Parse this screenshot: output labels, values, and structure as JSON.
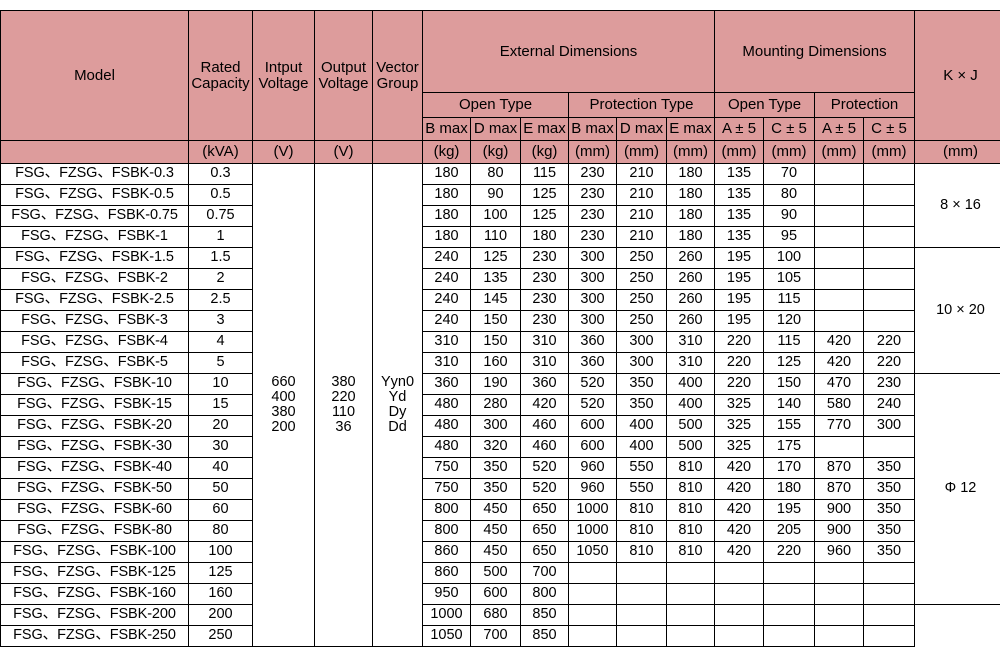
{
  "table": {
    "header": {
      "model": "Model",
      "rated_capacity": "Rated\nCapacity",
      "rated_capacity_l1": "Rated",
      "rated_capacity_l2": "Capacity",
      "input_voltage_l1": "Intput",
      "input_voltage_l2": "Voltage",
      "output_voltage_l1": "Output",
      "output_voltage_l2": "Voltage",
      "vector_group_l1": "Vector",
      "vector_group_l2": "Group",
      "external_dimensions": "External Dimensions",
      "mounting_dimensions": "Mounting Dimensions",
      "kxj": "K × J",
      "open_type": "Open Type",
      "protection_type": "Protection Type",
      "open_type_mount": "Open Type",
      "protection_mount": "Protection",
      "b_max": "B max",
      "d_max": "D max",
      "e_max": "E max",
      "a_tol": "A ± 5",
      "c_tol": "C ± 5",
      "unit_kva": "(kVA)",
      "unit_v": "(V)",
      "unit_kg": "(kg)",
      "unit_mm": "(mm)",
      "unit_blank": ""
    },
    "merged": {
      "input_voltage": "660\n400\n380\n200",
      "input_voltage_values": [
        "660",
        "400",
        "380",
        "200"
      ],
      "output_voltage": "380\n220\n110\n36",
      "output_voltage_values": [
        "380",
        "220",
        "110",
        "36"
      ],
      "vector_group": "Yyn0\nYd\nDy\nDd",
      "vector_group_values": [
        "Yyn0",
        "Yd",
        "Dy",
        "Dd"
      ]
    },
    "kxj_groups": [
      {
        "label": "8 × 16",
        "rowspan": 4
      },
      {
        "label": "10 × 20",
        "rowspan": 6
      },
      {
        "label": "Φ 12",
        "rowspan": 11
      }
    ],
    "rows": [
      {
        "model": "FSG、FZSG、FSBK-0.3",
        "capacity": "0.3",
        "ext_open_b": "180",
        "ext_open_d": "80",
        "ext_open_e": "115",
        "ext_prot_b": "230",
        "ext_prot_d": "210",
        "ext_prot_e": "180",
        "mnt_open_a": "135",
        "mnt_open_c": "70",
        "mnt_prot_a": "",
        "mnt_prot_c": ""
      },
      {
        "model": "FSG、FZSG、FSBK-0.5",
        "capacity": "0.5",
        "ext_open_b": "180",
        "ext_open_d": "90",
        "ext_open_e": "125",
        "ext_prot_b": "230",
        "ext_prot_d": "210",
        "ext_prot_e": "180",
        "mnt_open_a": "135",
        "mnt_open_c": "80",
        "mnt_prot_a": "",
        "mnt_prot_c": ""
      },
      {
        "model": "FSG、FZSG、FSBK-0.75",
        "capacity": "0.75",
        "ext_open_b": "180",
        "ext_open_d": "100",
        "ext_open_e": "125",
        "ext_prot_b": "230",
        "ext_prot_d": "210",
        "ext_prot_e": "180",
        "mnt_open_a": "135",
        "mnt_open_c": "90",
        "mnt_prot_a": "",
        "mnt_prot_c": ""
      },
      {
        "model": "FSG、FZSG、FSBK-1",
        "capacity": "1",
        "ext_open_b": "180",
        "ext_open_d": "110",
        "ext_open_e": "180",
        "ext_prot_b": "230",
        "ext_prot_d": "210",
        "ext_prot_e": "180",
        "mnt_open_a": "135",
        "mnt_open_c": "95",
        "mnt_prot_a": "",
        "mnt_prot_c": ""
      },
      {
        "model": "FSG、FZSG、FSBK-1.5",
        "capacity": "1.5",
        "ext_open_b": "240",
        "ext_open_d": "125",
        "ext_open_e": "230",
        "ext_prot_b": "300",
        "ext_prot_d": "250",
        "ext_prot_e": "260",
        "mnt_open_a": "195",
        "mnt_open_c": "100",
        "mnt_prot_a": "",
        "mnt_prot_c": ""
      },
      {
        "model": "FSG、FZSG、FSBK-2",
        "capacity": "2",
        "ext_open_b": "240",
        "ext_open_d": "135",
        "ext_open_e": "230",
        "ext_prot_b": "300",
        "ext_prot_d": "250",
        "ext_prot_e": "260",
        "mnt_open_a": "195",
        "mnt_open_c": "105",
        "mnt_prot_a": "",
        "mnt_prot_c": ""
      },
      {
        "model": "FSG、FZSG、FSBK-2.5",
        "capacity": "2.5",
        "ext_open_b": "240",
        "ext_open_d": "145",
        "ext_open_e": "230",
        "ext_prot_b": "300",
        "ext_prot_d": "250",
        "ext_prot_e": "260",
        "mnt_open_a": "195",
        "mnt_open_c": "115",
        "mnt_prot_a": "",
        "mnt_prot_c": ""
      },
      {
        "model": "FSG、FZSG、FSBK-3",
        "capacity": "3",
        "ext_open_b": "240",
        "ext_open_d": "150",
        "ext_open_e": "230",
        "ext_prot_b": "300",
        "ext_prot_d": "250",
        "ext_prot_e": "260",
        "mnt_open_a": "195",
        "mnt_open_c": "120",
        "mnt_prot_a": "",
        "mnt_prot_c": ""
      },
      {
        "model": "FSG、FZSG、FSBK-4",
        "capacity": "4",
        "ext_open_b": "310",
        "ext_open_d": "150",
        "ext_open_e": "310",
        "ext_prot_b": "360",
        "ext_prot_d": "300",
        "ext_prot_e": "310",
        "mnt_open_a": "220",
        "mnt_open_c": "115",
        "mnt_prot_a": "420",
        "mnt_prot_c": "220"
      },
      {
        "model": "FSG、FZSG、FSBK-5",
        "capacity": "5",
        "ext_open_b": "310",
        "ext_open_d": "160",
        "ext_open_e": "310",
        "ext_prot_b": "360",
        "ext_prot_d": "300",
        "ext_prot_e": "310",
        "mnt_open_a": "220",
        "mnt_open_c": "125",
        "mnt_prot_a": "420",
        "mnt_prot_c": "220"
      },
      {
        "model": "FSG、FZSG、FSBK-10",
        "capacity": "10",
        "ext_open_b": "360",
        "ext_open_d": "190",
        "ext_open_e": "360",
        "ext_prot_b": "520",
        "ext_prot_d": "350",
        "ext_prot_e": "400",
        "mnt_open_a": "220",
        "mnt_open_c": "150",
        "mnt_prot_a": "470",
        "mnt_prot_c": "230"
      },
      {
        "model": "FSG、FZSG、FSBK-15",
        "capacity": "15",
        "ext_open_b": "480",
        "ext_open_d": "280",
        "ext_open_e": "420",
        "ext_prot_b": "520",
        "ext_prot_d": "350",
        "ext_prot_e": "400",
        "mnt_open_a": "325",
        "mnt_open_c": "140",
        "mnt_prot_a": "580",
        "mnt_prot_c": "240"
      },
      {
        "model": "FSG、FZSG、FSBK-20",
        "capacity": "20",
        "ext_open_b": "480",
        "ext_open_d": "300",
        "ext_open_e": "460",
        "ext_prot_b": "600",
        "ext_prot_d": "400",
        "ext_prot_e": "500",
        "mnt_open_a": "325",
        "mnt_open_c": "155",
        "mnt_prot_a": "770",
        "mnt_prot_c": "300"
      },
      {
        "model": "FSG、FZSG、FSBK-30",
        "capacity": "30",
        "ext_open_b": "480",
        "ext_open_d": "320",
        "ext_open_e": "460",
        "ext_prot_b": "600",
        "ext_prot_d": "400",
        "ext_prot_e": "500",
        "mnt_open_a": "325",
        "mnt_open_c": "175",
        "mnt_prot_a": "",
        "mnt_prot_c": ""
      },
      {
        "model": "FSG、FZSG、FSBK-40",
        "capacity": "40",
        "ext_open_b": "750",
        "ext_open_d": "350",
        "ext_open_e": "520",
        "ext_prot_b": "960",
        "ext_prot_d": "550",
        "ext_prot_e": "810",
        "mnt_open_a": "420",
        "mnt_open_c": "170",
        "mnt_prot_a": "870",
        "mnt_prot_c": "350"
      },
      {
        "model": "FSG、FZSG、FSBK-50",
        "capacity": "50",
        "ext_open_b": "750",
        "ext_open_d": "350",
        "ext_open_e": "520",
        "ext_prot_b": "960",
        "ext_prot_d": "550",
        "ext_prot_e": "810",
        "mnt_open_a": "420",
        "mnt_open_c": "180",
        "mnt_prot_a": "870",
        "mnt_prot_c": "350"
      },
      {
        "model": "FSG、FZSG、FSBK-60",
        "capacity": "60",
        "ext_open_b": "800",
        "ext_open_d": "450",
        "ext_open_e": "650",
        "ext_prot_b": "1000",
        "ext_prot_d": "810",
        "ext_prot_e": "810",
        "mnt_open_a": "420",
        "mnt_open_c": "195",
        "mnt_prot_a": "900",
        "mnt_prot_c": "350"
      },
      {
        "model": "FSG、FZSG、FSBK-80",
        "capacity": "80",
        "ext_open_b": "800",
        "ext_open_d": "450",
        "ext_open_e": "650",
        "ext_prot_b": "1000",
        "ext_prot_d": "810",
        "ext_prot_e": "810",
        "mnt_open_a": "420",
        "mnt_open_c": "205",
        "mnt_prot_a": "900",
        "mnt_prot_c": "350"
      },
      {
        "model": "FSG、FZSG、FSBK-100",
        "capacity": "100",
        "ext_open_b": "860",
        "ext_open_d": "450",
        "ext_open_e": "650",
        "ext_prot_b": "1050",
        "ext_prot_d": "810",
        "ext_prot_e": "810",
        "mnt_open_a": "420",
        "mnt_open_c": "220",
        "mnt_prot_a": "960",
        "mnt_prot_c": "350"
      },
      {
        "model": "FSG、FZSG、FSBK-125",
        "capacity": "125",
        "ext_open_b": "860",
        "ext_open_d": "500",
        "ext_open_e": "700",
        "ext_prot_b": "",
        "ext_prot_d": "",
        "ext_prot_e": "",
        "mnt_open_a": "",
        "mnt_open_c": "",
        "mnt_prot_a": "",
        "mnt_prot_c": ""
      },
      {
        "model": "FSG、FZSG、FSBK-160",
        "capacity": "160",
        "ext_open_b": "950",
        "ext_open_d": "600",
        "ext_open_e": "800",
        "ext_prot_b": "",
        "ext_prot_d": "",
        "ext_prot_e": "",
        "mnt_open_a": "",
        "mnt_open_c": "",
        "mnt_prot_a": "",
        "mnt_prot_c": ""
      },
      {
        "model": "FSG、FZSG、FSBK-200",
        "capacity": "200",
        "ext_open_b": "1000",
        "ext_open_d": "680",
        "ext_open_e": "850",
        "ext_prot_b": "",
        "ext_prot_d": "",
        "ext_prot_e": "",
        "mnt_open_a": "",
        "mnt_open_c": "",
        "mnt_prot_a": "",
        "mnt_prot_c": ""
      },
      {
        "model": "FSG、FZSG、FSBK-250",
        "capacity": "250",
        "ext_open_b": "1050",
        "ext_open_d": "700",
        "ext_open_e": "850",
        "ext_prot_b": "",
        "ext_prot_d": "",
        "ext_prot_e": "",
        "mnt_open_a": "",
        "mnt_open_c": "",
        "mnt_prot_a": "",
        "mnt_prot_c": ""
      }
    ]
  },
  "colors": {
    "header_background": "#dd9c9c",
    "border": "#000000",
    "text": "#000000",
    "page_background": "#ffffff"
  }
}
